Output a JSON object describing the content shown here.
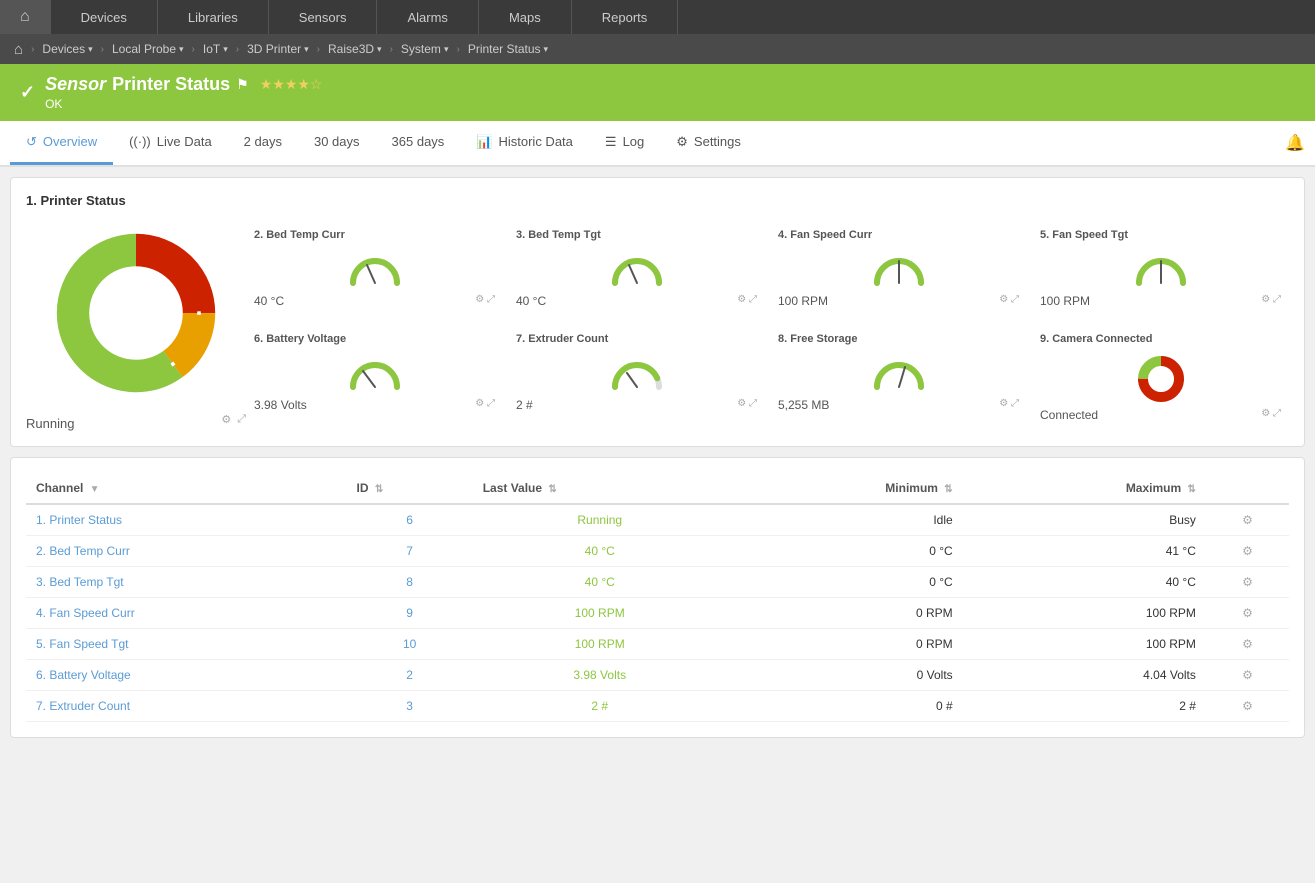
{
  "topnav": {
    "items": [
      "Home",
      "Devices",
      "Libraries",
      "Sensors",
      "Alarms",
      "Maps",
      "Reports"
    ]
  },
  "breadcrumb": {
    "home_icon": "⌂",
    "items": [
      "Devices",
      "Local Probe",
      "IoT",
      "3D Printer",
      "Raise3D",
      "System",
      "Printer Status"
    ]
  },
  "titlebar": {
    "check": "✓",
    "sensor_label": "Sensor",
    "title": " Printer Status",
    "flag": "⚑",
    "stars": "★★★★☆",
    "status": "OK"
  },
  "tabs": {
    "items": [
      {
        "label": "Overview",
        "icon": "↺",
        "active": true
      },
      {
        "label": "Live Data",
        "icon": "((·))"
      },
      {
        "label": "2 days",
        "icon": ""
      },
      {
        "label": "30 days",
        "icon": ""
      },
      {
        "label": "365 days",
        "icon": ""
      },
      {
        "label": "Historic Data",
        "icon": "📊"
      },
      {
        "label": "Log",
        "icon": "☰"
      },
      {
        "label": "Settings",
        "icon": "⚙"
      }
    ]
  },
  "sensor_card": {
    "title": "1. Printer Status",
    "running_label": "Running",
    "donut": {
      "segments": [
        {
          "color": "#cc2200",
          "value": 25
        },
        {
          "color": "#e8a000",
          "value": 15
        },
        {
          "color": "#8dc63f",
          "value": 60
        }
      ]
    },
    "gauges": [
      {
        "id": "2",
        "title": "2. Bed Temp Curr",
        "value": "40 °C",
        "angle": -45,
        "colors": [
          "#8dc63f",
          "#ccc"
        ]
      },
      {
        "id": "3",
        "title": "3. Bed Temp Tgt",
        "value": "40 °C",
        "angle": -45,
        "colors": [
          "#8dc63f",
          "#ccc"
        ]
      },
      {
        "id": "4",
        "title": "4. Fan Speed Curr",
        "value": "100 RPM",
        "angle": 10,
        "colors": [
          "#8dc63f",
          "#ccc"
        ]
      },
      {
        "id": "5",
        "title": "5. Fan Speed Tgt",
        "value": "100 RPM",
        "angle": 10,
        "colors": [
          "#8dc63f",
          "#ccc"
        ]
      },
      {
        "id": "6",
        "title": "6. Battery Voltage",
        "value": "3.98 Volts",
        "angle": -30,
        "colors": [
          "#8dc63f",
          "#ccc"
        ]
      },
      {
        "id": "7",
        "title": "7. Extruder Count",
        "value": "2 #",
        "angle": -40,
        "colors": [
          "#8dc63f",
          "#ccc"
        ]
      },
      {
        "id": "8",
        "title": "8. Free Storage",
        "value": "5,255 MB",
        "angle": 20,
        "colors": [
          "#8dc63f",
          "#ccc"
        ]
      },
      {
        "id": "9",
        "title": "9. Camera Connected",
        "value": "Connected",
        "angle": 0,
        "colors": [
          "#cc2200",
          "#8dc63f"
        ],
        "camera": true
      }
    ]
  },
  "table": {
    "columns": [
      {
        "label": "Channel",
        "sort": true
      },
      {
        "label": "ID",
        "sort": true
      },
      {
        "label": "Last Value",
        "sort": true
      },
      {
        "label": "Minimum",
        "sort": true
      },
      {
        "label": "Maximum",
        "sort": true
      },
      {
        "label": "",
        "sort": false
      }
    ],
    "rows": [
      {
        "channel": "1. Printer Status",
        "id": "6",
        "last_value": "Running",
        "minimum": "Idle",
        "maximum": "Busy"
      },
      {
        "channel": "2. Bed Temp Curr",
        "id": "7",
        "last_value": "40 °C",
        "minimum": "0 °C",
        "maximum": "41 °C"
      },
      {
        "channel": "3. Bed Temp Tgt",
        "id": "8",
        "last_value": "40 °C",
        "minimum": "0 °C",
        "maximum": "40 °C"
      },
      {
        "channel": "4. Fan Speed Curr",
        "id": "9",
        "last_value": "100 RPM",
        "minimum": "0 RPM",
        "maximum": "100 RPM"
      },
      {
        "channel": "5. Fan Speed Tgt",
        "id": "10",
        "last_value": "100 RPM",
        "minimum": "0 RPM",
        "maximum": "100 RPM"
      },
      {
        "channel": "6. Battery Voltage",
        "id": "2",
        "last_value": "3.98 Volts",
        "minimum": "0 Volts",
        "maximum": "4.04 Volts"
      },
      {
        "channel": "7. Extruder Count",
        "id": "3",
        "last_value": "2 #",
        "minimum": "0 #",
        "maximum": "2 #"
      }
    ]
  },
  "colors": {
    "accent": "#8dc63f",
    "nav_bg": "#3a3a3a",
    "breadcrumb_bg": "#4a4a4a",
    "link": "#5b9bd5"
  }
}
